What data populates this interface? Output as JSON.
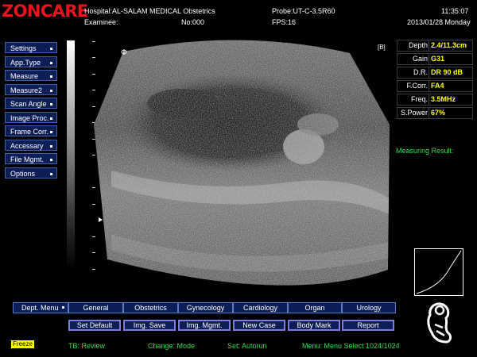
{
  "header": {
    "logo": "ZONCARE",
    "hospital": "Hospital:AL-SALAM MEDICAL Obstetrics",
    "examinee": "Examinee:",
    "no": "No:000",
    "probe": "Probe:UT-C-3.5R60",
    "fps": "FPS:16",
    "time": "11:35:07",
    "date": "2013/01/28 Monday"
  },
  "left_menu": [
    {
      "label": "Settings"
    },
    {
      "label": "App.Type"
    },
    {
      "label": "Measure"
    },
    {
      "label": "Measure2"
    },
    {
      "label": "Scan Angle"
    },
    {
      "label": "Image Proc."
    },
    {
      "label": "Frame Corr."
    },
    {
      "label": "Accessary"
    },
    {
      "label": "File Mgmt."
    },
    {
      "label": "Options"
    }
  ],
  "image": {
    "focus_glyph": "Φ",
    "frame_badge": "[B]"
  },
  "params": [
    {
      "label": "Depth",
      "value": "2.4/11.3cm"
    },
    {
      "label": "Gain",
      "value": "G31"
    },
    {
      "label": "D.R.",
      "value": "DR 90 dB"
    },
    {
      "label": "F.Corr.",
      "value": "FA4"
    },
    {
      "label": "Freq.",
      "value": "3.5MHz"
    },
    {
      "label": "S.Power",
      "value": "67%"
    }
  ],
  "measuring_result": "Measuring Result:",
  "dept_menu": {
    "label": "Dept. Menu",
    "items": [
      "General",
      "Obstetrics",
      "Gynecology",
      "Cardiology",
      "Organ",
      "Urology"
    ]
  },
  "action_buttons": [
    "Set Default",
    "Img. Save",
    "Img. Mgmt.",
    "New Case",
    "Body Mark",
    "Report"
  ],
  "status": {
    "freeze": "Freeze",
    "tb": "TB: Review",
    "change": "Change: Mode",
    "set": "Set: Autorun",
    "menu": "Menu: Menu Select  1024/1024"
  },
  "colors": {
    "logo": "#e8141b",
    "accent_green": "#37d64c",
    "value_yellow": "#ffff00",
    "button_bg": "#0c1e56"
  },
  "icons": {
    "curve": "gain-curve-icon",
    "body_mark": "fetus-body-mark-icon"
  }
}
